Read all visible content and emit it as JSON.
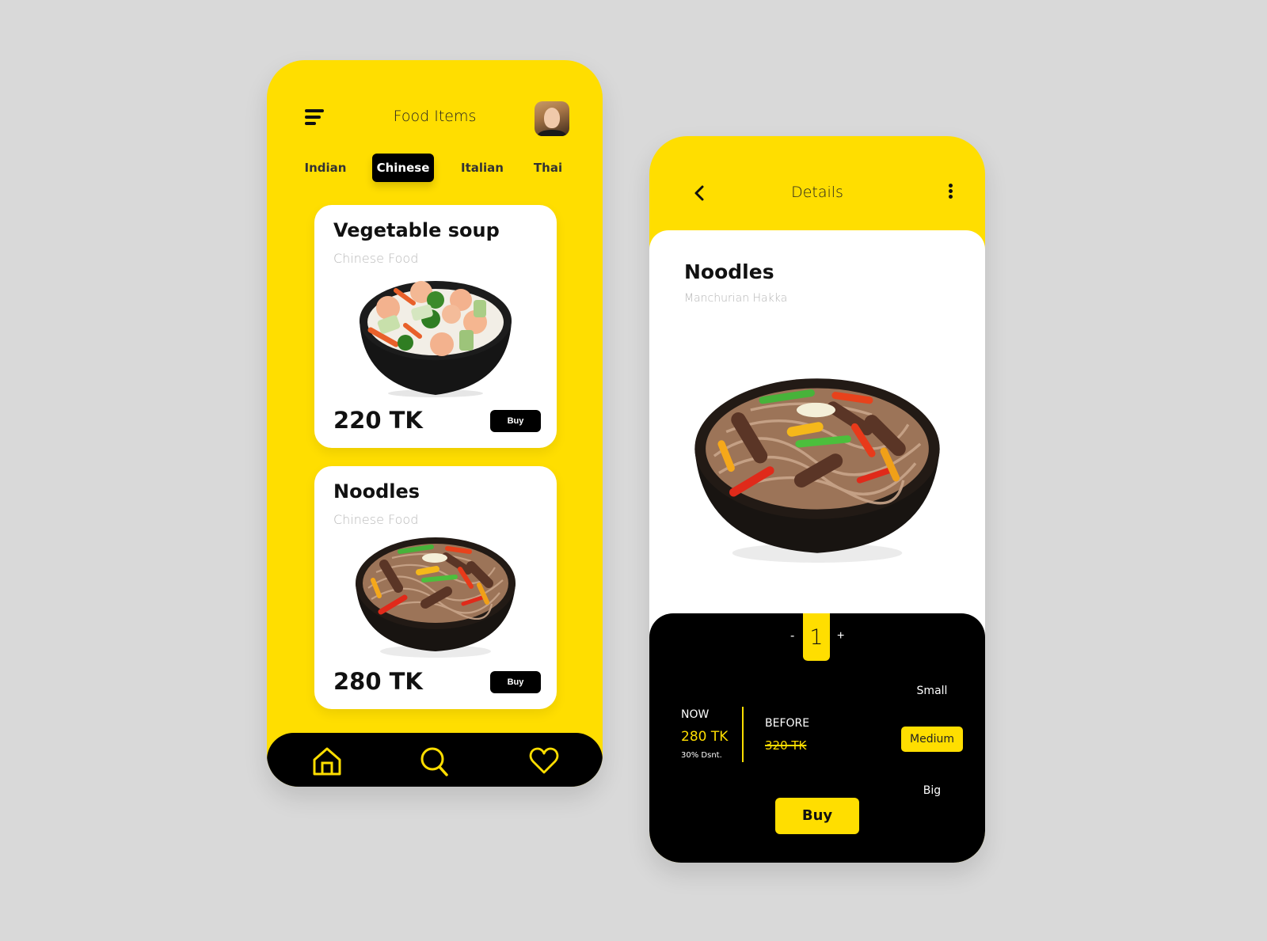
{
  "colors": {
    "accent": "#ffde00",
    "dark": "#000000",
    "background": "#d9d9d9"
  },
  "list_screen": {
    "title": "Food Items",
    "menu_icon": "hamburger-menu-icon",
    "avatar_icon": "user-avatar",
    "tabs": [
      {
        "label": "Indian",
        "active": false
      },
      {
        "label": "Chinese",
        "active": true
      },
      {
        "label": "Italian",
        "active": false
      },
      {
        "label": "Thai",
        "active": false
      }
    ],
    "items": [
      {
        "name": "Vegetable soup",
        "category": "Chinese Food",
        "price": "220 TK",
        "buy_label": "Buy",
        "image": "shrimp-vegetable-soup-bowl"
      },
      {
        "name": "Noodles",
        "category": "Chinese Food",
        "price": "280 TK",
        "buy_label": "Buy",
        "image": "beef-noodle-bowl"
      }
    ],
    "bottom_nav": [
      {
        "icon": "home-icon"
      },
      {
        "icon": "search-icon"
      },
      {
        "icon": "heart-icon"
      }
    ]
  },
  "detail_screen": {
    "title": "Details",
    "back_icon": "chevron-left-icon",
    "more_icon": "more-vertical-icon",
    "item": {
      "name": "Noodles",
      "subtitle": "Manchurian Hakka",
      "image": "beef-noodle-bowl"
    },
    "quantity": {
      "minus": "-",
      "value": "1",
      "plus": "+"
    },
    "pricing": {
      "now_label": "NOW",
      "now_price": "280 TK",
      "discount": "30% Dsnt.",
      "before_label": "BEFORE",
      "before_price": "320 TK"
    },
    "sizes": [
      {
        "label": "Small",
        "selected": false
      },
      {
        "label": "Medium",
        "selected": true
      },
      {
        "label": "Big",
        "selected": false
      }
    ],
    "buy_label": "Buy"
  }
}
